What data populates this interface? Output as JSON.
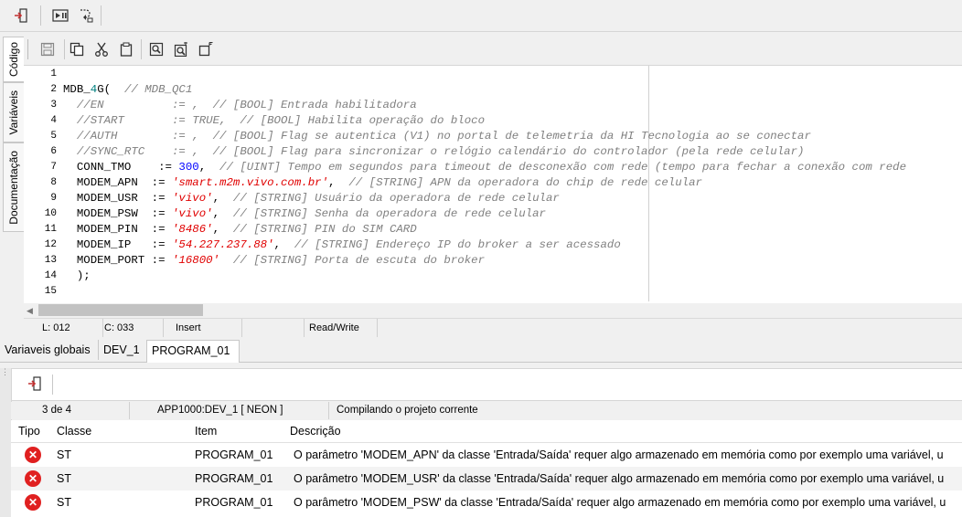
{
  "top_toolbar": {
    "icons": [
      "exit-icon",
      "play-pause-icon",
      "step-into-icon"
    ]
  },
  "vertical_tabs": [
    {
      "label": "Código",
      "active": true
    },
    {
      "label": "Variáveis",
      "active": false
    },
    {
      "label": "Documentação",
      "active": false
    }
  ],
  "editor_toolbar": {
    "icons": [
      "save-icon",
      "copy-icon",
      "cut-icon",
      "paste-icon",
      "find-icon",
      "replace-icon",
      "find-next-icon"
    ]
  },
  "editor": {
    "line_numbers": [
      "1",
      "2",
      "3",
      "4",
      "5",
      "6",
      "7",
      "8",
      "9",
      "10",
      "11",
      "12",
      "13",
      "14",
      "15"
    ],
    "lines": [
      [],
      [
        {
          "t": "MDB_",
          "c": ""
        },
        {
          "t": "4",
          "c": "hl"
        },
        {
          "t": "G(  ",
          "c": ""
        },
        {
          "t": "// MDB_QC1",
          "c": "cm"
        }
      ],
      [
        {
          "t": "  //EN          := ,  // [BOOL] Entrada habilitadora",
          "c": "cm"
        }
      ],
      [
        {
          "t": "  //START       := TRUE,  // [BOOL] Habilita operação do bloco",
          "c": "cm"
        }
      ],
      [
        {
          "t": "  //AUTH        := ,  // [BOOL] Flag se autentica (V1) no portal de telemetria da HI Tecnologia ao se conectar",
          "c": "cm"
        }
      ],
      [
        {
          "t": "  //SYNC_RTC    := ,  // [BOOL] Flag para sincronizar o relógio calendário do controlador (pela rede celular)",
          "c": "cm"
        }
      ],
      [
        {
          "t": "  CONN_TMO    := ",
          "c": ""
        },
        {
          "t": "300",
          "c": "num"
        },
        {
          "t": ",  ",
          "c": ""
        },
        {
          "t": "// [UINT] Tempo em segundos para timeout de desconexão com rede (tempo para fechar a conexão com rede",
          "c": "cm"
        }
      ],
      [
        {
          "t": "  MODEM_APN  := ",
          "c": ""
        },
        {
          "t": "'smart.m2m.vivo.com.br'",
          "c": "str"
        },
        {
          "t": ",  ",
          "c": ""
        },
        {
          "t": "// [STRING] APN da operadora do chip de rede celular",
          "c": "cm"
        }
      ],
      [
        {
          "t": "  MODEM_USR  := ",
          "c": ""
        },
        {
          "t": "'vivo'",
          "c": "str"
        },
        {
          "t": ",  ",
          "c": ""
        },
        {
          "t": "// [STRING] Usuário da operadora de rede celular",
          "c": "cm"
        }
      ],
      [
        {
          "t": "  MODEM_PSW  := ",
          "c": ""
        },
        {
          "t": "'vivo'",
          "c": "str"
        },
        {
          "t": ",  ",
          "c": ""
        },
        {
          "t": "// [STRING] Senha da operadora de rede celular",
          "c": "cm"
        }
      ],
      [
        {
          "t": "  MODEM_PIN  := ",
          "c": ""
        },
        {
          "t": "'8486'",
          "c": "str"
        },
        {
          "t": ",  ",
          "c": ""
        },
        {
          "t": "// [STRING] PIN do SIM CARD",
          "c": "cm"
        }
      ],
      [
        {
          "t": "  MODEM_IP   := ",
          "c": ""
        },
        {
          "t": "'54.227.237.88'",
          "c": "str"
        },
        {
          "t": ",  ",
          "c": ""
        },
        {
          "t": "// [STRING] Endereço IP do broker a ser acessado",
          "c": "cm"
        }
      ],
      [
        {
          "t": "  MODEM_PORT := ",
          "c": ""
        },
        {
          "t": "'16800'",
          "c": "str"
        },
        {
          "t": "  ",
          "c": ""
        },
        {
          "t": "// [STRING] Porta de escuta do broker",
          "c": "cm"
        }
      ],
      [
        {
          "t": "  );",
          "c": ""
        }
      ],
      []
    ]
  },
  "statusbar": {
    "line": "L: 012",
    "col": "C: 033",
    "mode": "Insert",
    "access": "Read/Write"
  },
  "file_tabs": [
    {
      "label": "Variaveis globais",
      "active": false
    },
    {
      "label": "DEV_1",
      "active": false
    },
    {
      "label": "PROGRAM_01",
      "active": true
    }
  ],
  "messages": {
    "counter": "3 de 4",
    "device": "APP1000:DEV_1  [ NEON ]",
    "status": "Compilando o projeto corrente",
    "columns": [
      "Tipo",
      "Classe",
      "Item",
      "Descrição"
    ],
    "rows": [
      {
        "type_icon": "error-icon",
        "classe": "ST",
        "item": "PROGRAM_01",
        "descricao": "O parâmetro 'MODEM_APN' da classe 'Entrada/Saída' requer algo armazenado em memória como por exemplo uma variável, u"
      },
      {
        "type_icon": "error-icon",
        "classe": "ST",
        "item": "PROGRAM_01",
        "descricao": "O parâmetro 'MODEM_USR' da classe 'Entrada/Saída' requer algo armazenado em memória como por exemplo uma variável, u"
      },
      {
        "type_icon": "error-icon",
        "classe": "ST",
        "item": "PROGRAM_01",
        "descricao": "O parâmetro 'MODEM_PSW' da classe 'Entrada/Saída' requer algo armazenado em memória como por exemplo uma variável, u"
      }
    ]
  }
}
